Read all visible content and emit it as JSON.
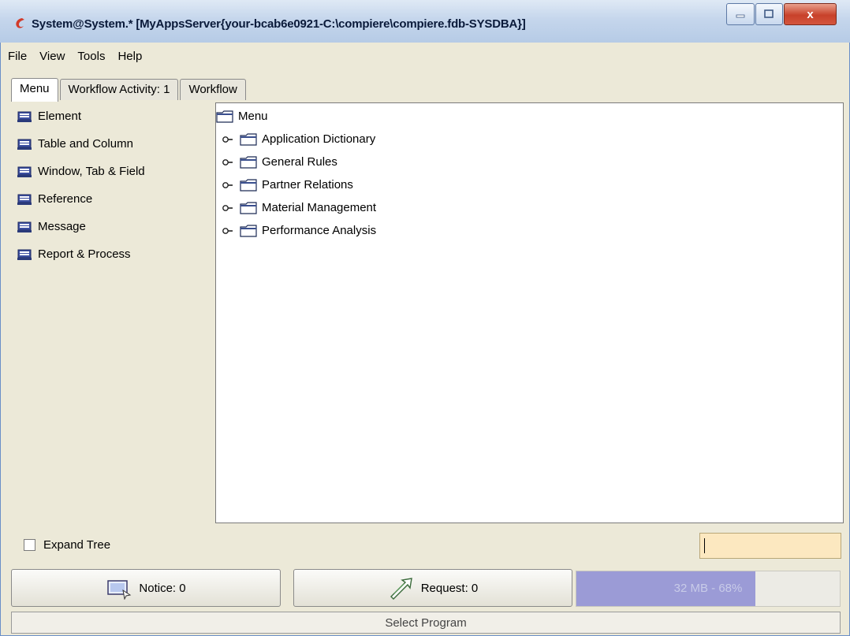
{
  "window": {
    "title": "System@System.* [MyAppsServer{your-bcab6e0921-C:\\compiere\\compiere.fdb-SYSDBA}]",
    "close_label": "x"
  },
  "menubar": {
    "items": [
      {
        "label": "File"
      },
      {
        "label": "View"
      },
      {
        "label": "Tools"
      },
      {
        "label": "Help"
      }
    ]
  },
  "tabs": [
    {
      "label": "Menu",
      "active": true
    },
    {
      "label": "Workflow Activity: 1",
      "active": false
    },
    {
      "label": "Workflow",
      "active": false
    }
  ],
  "left_panel": {
    "items": [
      {
        "label": "Element"
      },
      {
        "label": "Table and Column"
      },
      {
        "label": "Window, Tab & Field"
      },
      {
        "label": "Reference"
      },
      {
        "label": "Message"
      },
      {
        "label": "Report & Process"
      }
    ]
  },
  "tree": {
    "root": "Menu",
    "items": [
      {
        "label": "Application Dictionary"
      },
      {
        "label": "General Rules"
      },
      {
        "label": "Partner Relations"
      },
      {
        "label": "Material Management"
      },
      {
        "label": "Performance Analysis"
      }
    ]
  },
  "bottom": {
    "expand_tree_label": "Expand Tree",
    "expand_tree_checked": false,
    "search_value": ""
  },
  "status": {
    "notice_label": "Notice: 0",
    "request_label": "Request: 0",
    "memory_label": "32 MB - 68%",
    "memory_percent": 68,
    "footer_text": "Select Program"
  },
  "colors": {
    "memory_fill": "#9b9bd6",
    "search_bg": "#fce8c0"
  }
}
